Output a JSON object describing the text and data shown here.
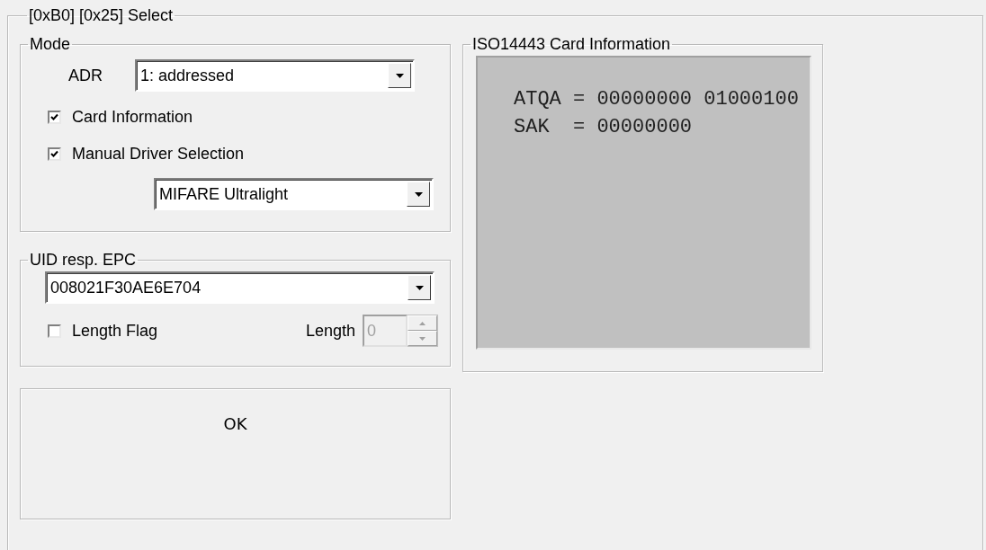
{
  "group": {
    "title": "[0xB0] [0x25] Select"
  },
  "mode": {
    "title": "Mode",
    "adr_label": "ADR",
    "adr_value": "1: addressed",
    "checkboxes": [
      {
        "label": "Card Information",
        "checked": true
      },
      {
        "label": "Manual Driver Selection",
        "checked": true
      }
    ],
    "driver_value": "MIFARE Ultralight"
  },
  "uid": {
    "title": "UID resp. EPC",
    "value": "008021F30AE6E704",
    "length_flag": {
      "label": "Length Flag",
      "checked": false
    },
    "length_label": "Length",
    "length_value": "0",
    "length_disabled": true
  },
  "status": {
    "text": "OK"
  },
  "card_info": {
    "title": "ISO14443 Card Information",
    "lines": [
      "ATQA = 00000000 01000100",
      "SAK  = 00000000"
    ]
  }
}
